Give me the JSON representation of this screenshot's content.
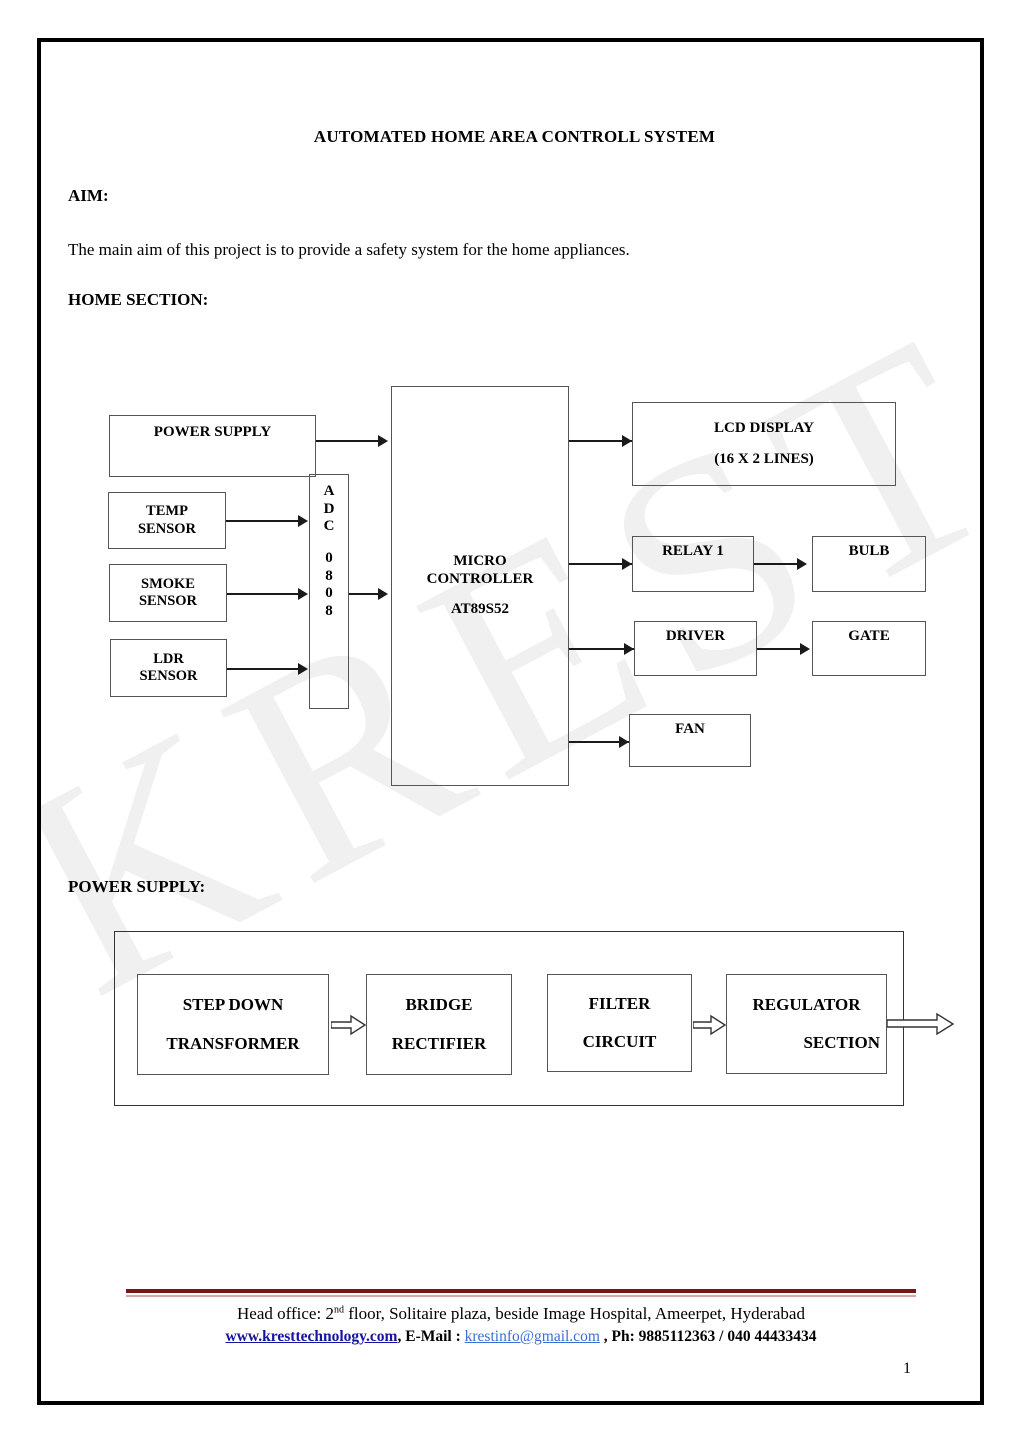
{
  "document": {
    "title": "AUTOMATED HOME AREA CONTROLL SYSTEM",
    "aim_label": "AIM:",
    "aim_text": "The main aim of this project is to provide a safety system for the home appliances.",
    "home_section_label": "HOME SECTION:",
    "power_supply_label": "POWER SUPPLY:",
    "watermark": "KREST",
    "page_number": "1"
  },
  "home_diagram": {
    "power_supply": {
      "label": "POWER SUPPLY"
    },
    "sensors": [
      {
        "line1": "TEMP",
        "line2": "SENSOR"
      },
      {
        "line1": "SMOKE",
        "line2": "SENSOR"
      },
      {
        "line1": "LDR",
        "line2": "SENSOR"
      }
    ],
    "adc": {
      "chars": [
        "A",
        "D",
        "C",
        "",
        "0",
        "8",
        "0",
        "8"
      ],
      "name": "ADC 0808"
    },
    "mcu": {
      "line1": "MICRO",
      "line2": "CONTROLLER",
      "line3": "AT89S52"
    },
    "outputs": {
      "lcd": {
        "line1": "LCD DISPLAY",
        "line2": "(16 X 2 LINES)"
      },
      "relay": {
        "label": "RELAY 1"
      },
      "bulb": {
        "label": "BULB"
      },
      "driver": {
        "label": "DRIVER"
      },
      "gate": {
        "label": "GATE"
      },
      "fan": {
        "label": "FAN"
      }
    }
  },
  "power_supply_diagram": {
    "blocks": [
      {
        "line1": "STEP DOWN",
        "line2": "TRANSFORMER"
      },
      {
        "line1": "BRIDGE",
        "line2": "RECTIFIER"
      },
      {
        "line1": "FILTER",
        "line2": "CIRCUIT"
      },
      {
        "line1": "REGULATOR",
        "line2": "SECTION"
      }
    ]
  },
  "footer": {
    "address": "Head office: 2",
    "address_sup": "nd",
    "address_rest": " floor, Solitaire plaza, beside Image Hospital, Ameerpet, Hyderabad",
    "website": "www.kresttechnology.com",
    "email_label": ", E-Mail : ",
    "email": "krestinfo@gmail.com",
    "phone": " , Ph: 9885112363 / 040 44433434"
  },
  "colors": {
    "rule_thick": "#7b1414",
    "rule_thin": "#d8a6a6",
    "web_link": "#1414a0",
    "mail_link": "#3a6fd8",
    "box_border": "#555555",
    "page_border": "#000000"
  }
}
